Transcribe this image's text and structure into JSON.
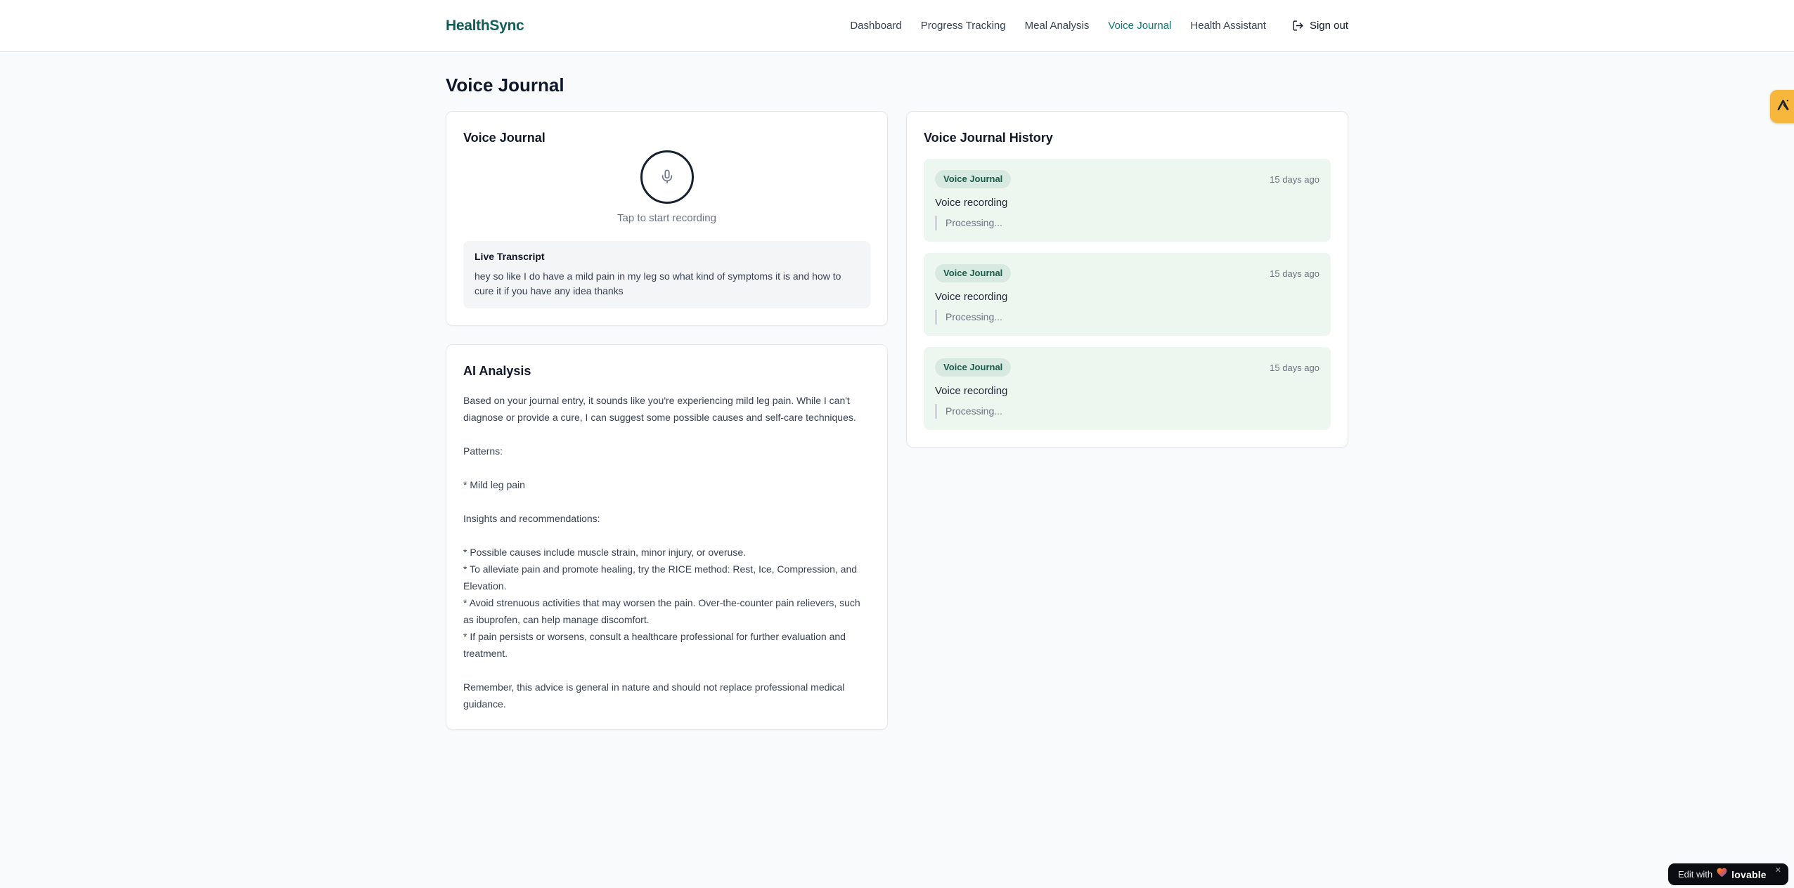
{
  "brand": {
    "name": "HealthSync"
  },
  "nav": {
    "items": [
      {
        "label": "Dashboard",
        "active": false
      },
      {
        "label": "Progress Tracking",
        "active": false
      },
      {
        "label": "Meal Analysis",
        "active": false
      },
      {
        "label": "Voice Journal",
        "active": true
      },
      {
        "label": "Health Assistant",
        "active": false
      }
    ],
    "sign_out_label": "Sign out"
  },
  "page": {
    "title": "Voice Journal"
  },
  "recorder": {
    "card_title": "Voice Journal",
    "tap_hint": "Tap to start recording",
    "transcript_title": "Live Transcript",
    "transcript_text": "hey so like I do have a mild pain in my leg so what kind of symptoms it is and how to cure it if you have any idea thanks"
  },
  "analysis": {
    "card_title": "AI Analysis",
    "body": "Based on your journal entry, it sounds like you're experiencing mild leg pain. While I can't diagnose or provide a cure, I can suggest some possible causes and self-care techniques.\n\nPatterns:\n\n* Mild leg pain\n\nInsights and recommendations:\n\n* Possible causes include muscle strain, minor injury, or overuse.\n* To alleviate pain and promote healing, try the RICE method: Rest, Ice, Compression, and Elevation.\n* Avoid strenuous activities that may worsen the pain. Over-the-counter pain relievers, such as ibuprofen, can help manage discomfort.\n* If pain persists or worsens, consult a healthcare professional for further evaluation and treatment.\n\nRemember, this advice is general in nature and should not replace professional medical guidance."
  },
  "history": {
    "card_title": "Voice Journal History",
    "entries": [
      {
        "badge": "Voice Journal",
        "time": "15 days ago",
        "body": "Voice recording",
        "status": "Processing..."
      },
      {
        "badge": "Voice Journal",
        "time": "15 days ago",
        "body": "Voice recording",
        "status": "Processing..."
      },
      {
        "badge": "Voice Journal",
        "time": "15 days ago",
        "body": "Voice recording",
        "status": "Processing..."
      }
    ]
  },
  "overlay": {
    "edit_label": "Edit with",
    "brand": "lovable",
    "close": "✕"
  },
  "colors": {
    "brand_teal": "#115e59",
    "active_nav_teal": "#0f766e",
    "history_entry_bg": "#eef6f0",
    "badge_bg": "#d7e9e0",
    "badge_text": "#1d5b4a",
    "edge_badge_amber": "#f6b73c",
    "pill_bg": "#0b0d12"
  }
}
